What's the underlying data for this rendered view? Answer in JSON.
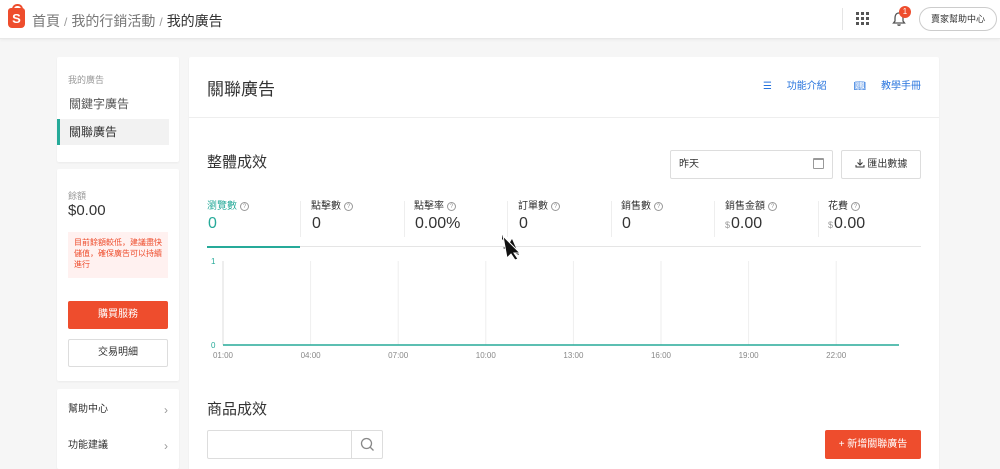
{
  "header": {
    "logo_letter": "S",
    "breadcrumb": [
      "首頁",
      "我的行銷活動",
      "我的廣告"
    ],
    "notification_count": "1",
    "help_center_label": "賣家幫助中心"
  },
  "sidebar": {
    "nav_heading": "我的廣告",
    "nav_items": [
      {
        "label": "關鍵字廣告",
        "active": false
      },
      {
        "label": "關聯廣告",
        "active": true
      }
    ],
    "balance_label": "餘額",
    "balance_value": "$0.00",
    "warning_text": "目前餘額較低，建議盡快儲值，確保廣告可以持續進行",
    "buy_button": "購買服務",
    "transactions_button": "交易明細",
    "links": [
      "幫助中心",
      "功能建議"
    ]
  },
  "main": {
    "title": "關聯廣告",
    "feature_intro_link": "功能介紹",
    "tutorial_link": "教學手冊",
    "overall_title": "整體成效",
    "date_value": "昨天",
    "export_button": "匯出數據",
    "metrics": [
      {
        "label": "瀏覽數",
        "value": "0",
        "currency": "",
        "active": true
      },
      {
        "label": "點擊數",
        "value": "0",
        "currency": "",
        "active": false
      },
      {
        "label": "點擊率",
        "value": "0.00%",
        "currency": "",
        "active": false
      },
      {
        "label": "訂單數",
        "value": "0",
        "currency": "",
        "active": false
      },
      {
        "label": "銷售數",
        "value": "0",
        "currency": "",
        "active": false
      },
      {
        "label": "銷售金額",
        "value": "0.00",
        "currency": "$",
        "active": false
      },
      {
        "label": "花費",
        "value": "0.00",
        "currency": "$",
        "active": false
      }
    ],
    "product_title": "商品成效",
    "search_placeholder": "",
    "add_button": "+ 新增關聯廣告"
  },
  "chart_data": {
    "type": "line",
    "x": [
      "01:00",
      "04:00",
      "07:00",
      "10:00",
      "13:00",
      "16:00",
      "19:00",
      "22:00"
    ],
    "series": [
      {
        "values": [
          0,
          0,
          0,
          0,
          0,
          0,
          0,
          0
        ],
        "color": "#26aa99"
      }
    ],
    "yticks": [
      "1",
      "0"
    ],
    "ylim": [
      0,
      1
    ],
    "grid": true
  },
  "colors": {
    "brand": "#ee4d2d",
    "accent": "#26aa99",
    "link": "#2673dd"
  },
  "icons": [
    "shopee-logo-icon",
    "apps-grid-icon",
    "bell-icon",
    "list-icon",
    "book-icon",
    "calendar-icon",
    "download-icon",
    "help-circle-icon",
    "chevron-right-icon",
    "search-icon",
    "cursor-arrow-icon"
  ]
}
